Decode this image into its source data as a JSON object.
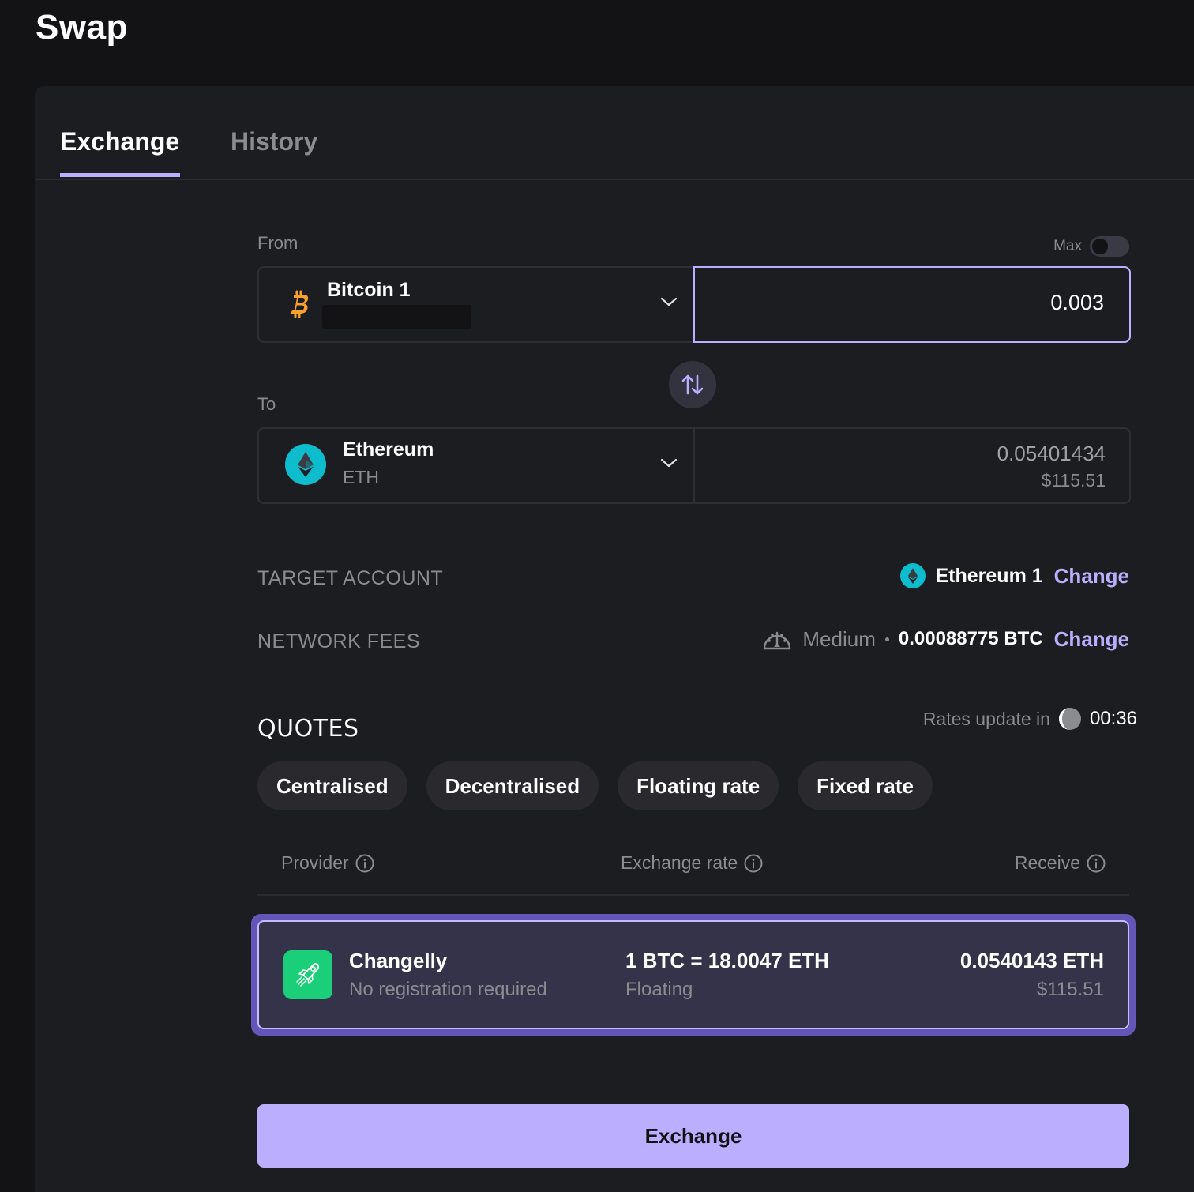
{
  "header": {
    "title": "Swap"
  },
  "tabs": [
    {
      "label": "Exchange",
      "active": true
    },
    {
      "label": "History",
      "active": false
    }
  ],
  "from": {
    "label": "From",
    "max_label": "Max",
    "max_enabled": false,
    "account_name": "Bitcoin 1",
    "icon": "bitcoin-icon",
    "amount": "0.003"
  },
  "swap_icon": "swap-arrows-icon",
  "to": {
    "label": "To",
    "currency_name": "Ethereum",
    "ticker": "ETH",
    "icon": "ethereum-icon",
    "amount": "0.05401434",
    "fiat": "$115.51"
  },
  "target_account": {
    "label": "TARGET ACCOUNT",
    "account_name": "Ethereum 1",
    "change_label": "Change"
  },
  "network_fees": {
    "label": "NETWORK FEES",
    "level": "Medium",
    "value": "0.00088775 BTC",
    "change_label": "Change"
  },
  "quotes": {
    "title": "QUOTES",
    "rates_label": "Rates update in",
    "countdown": "00:36",
    "filters": [
      "Centralised",
      "Decentralised",
      "Floating rate",
      "Fixed rate"
    ],
    "columns": [
      "Provider",
      "Exchange rate",
      "Receive"
    ],
    "items": [
      {
        "provider": "Changelly",
        "provider_note": "No registration required",
        "rate": "1 BTC = 18.0047 ETH",
        "rate_type": "Floating",
        "receive": "0.0540143 ETH",
        "receive_fiat": "$115.51",
        "selected": true
      }
    ]
  },
  "exchange_button": {
    "label": "Exchange"
  },
  "colors": {
    "accent": "#bbaeff",
    "selected_border": "#6456b9",
    "provider_green": "#1bcf7a",
    "bitcoin_orange": "#f7a02c",
    "ethereum_teal": "#0ebdcd"
  }
}
